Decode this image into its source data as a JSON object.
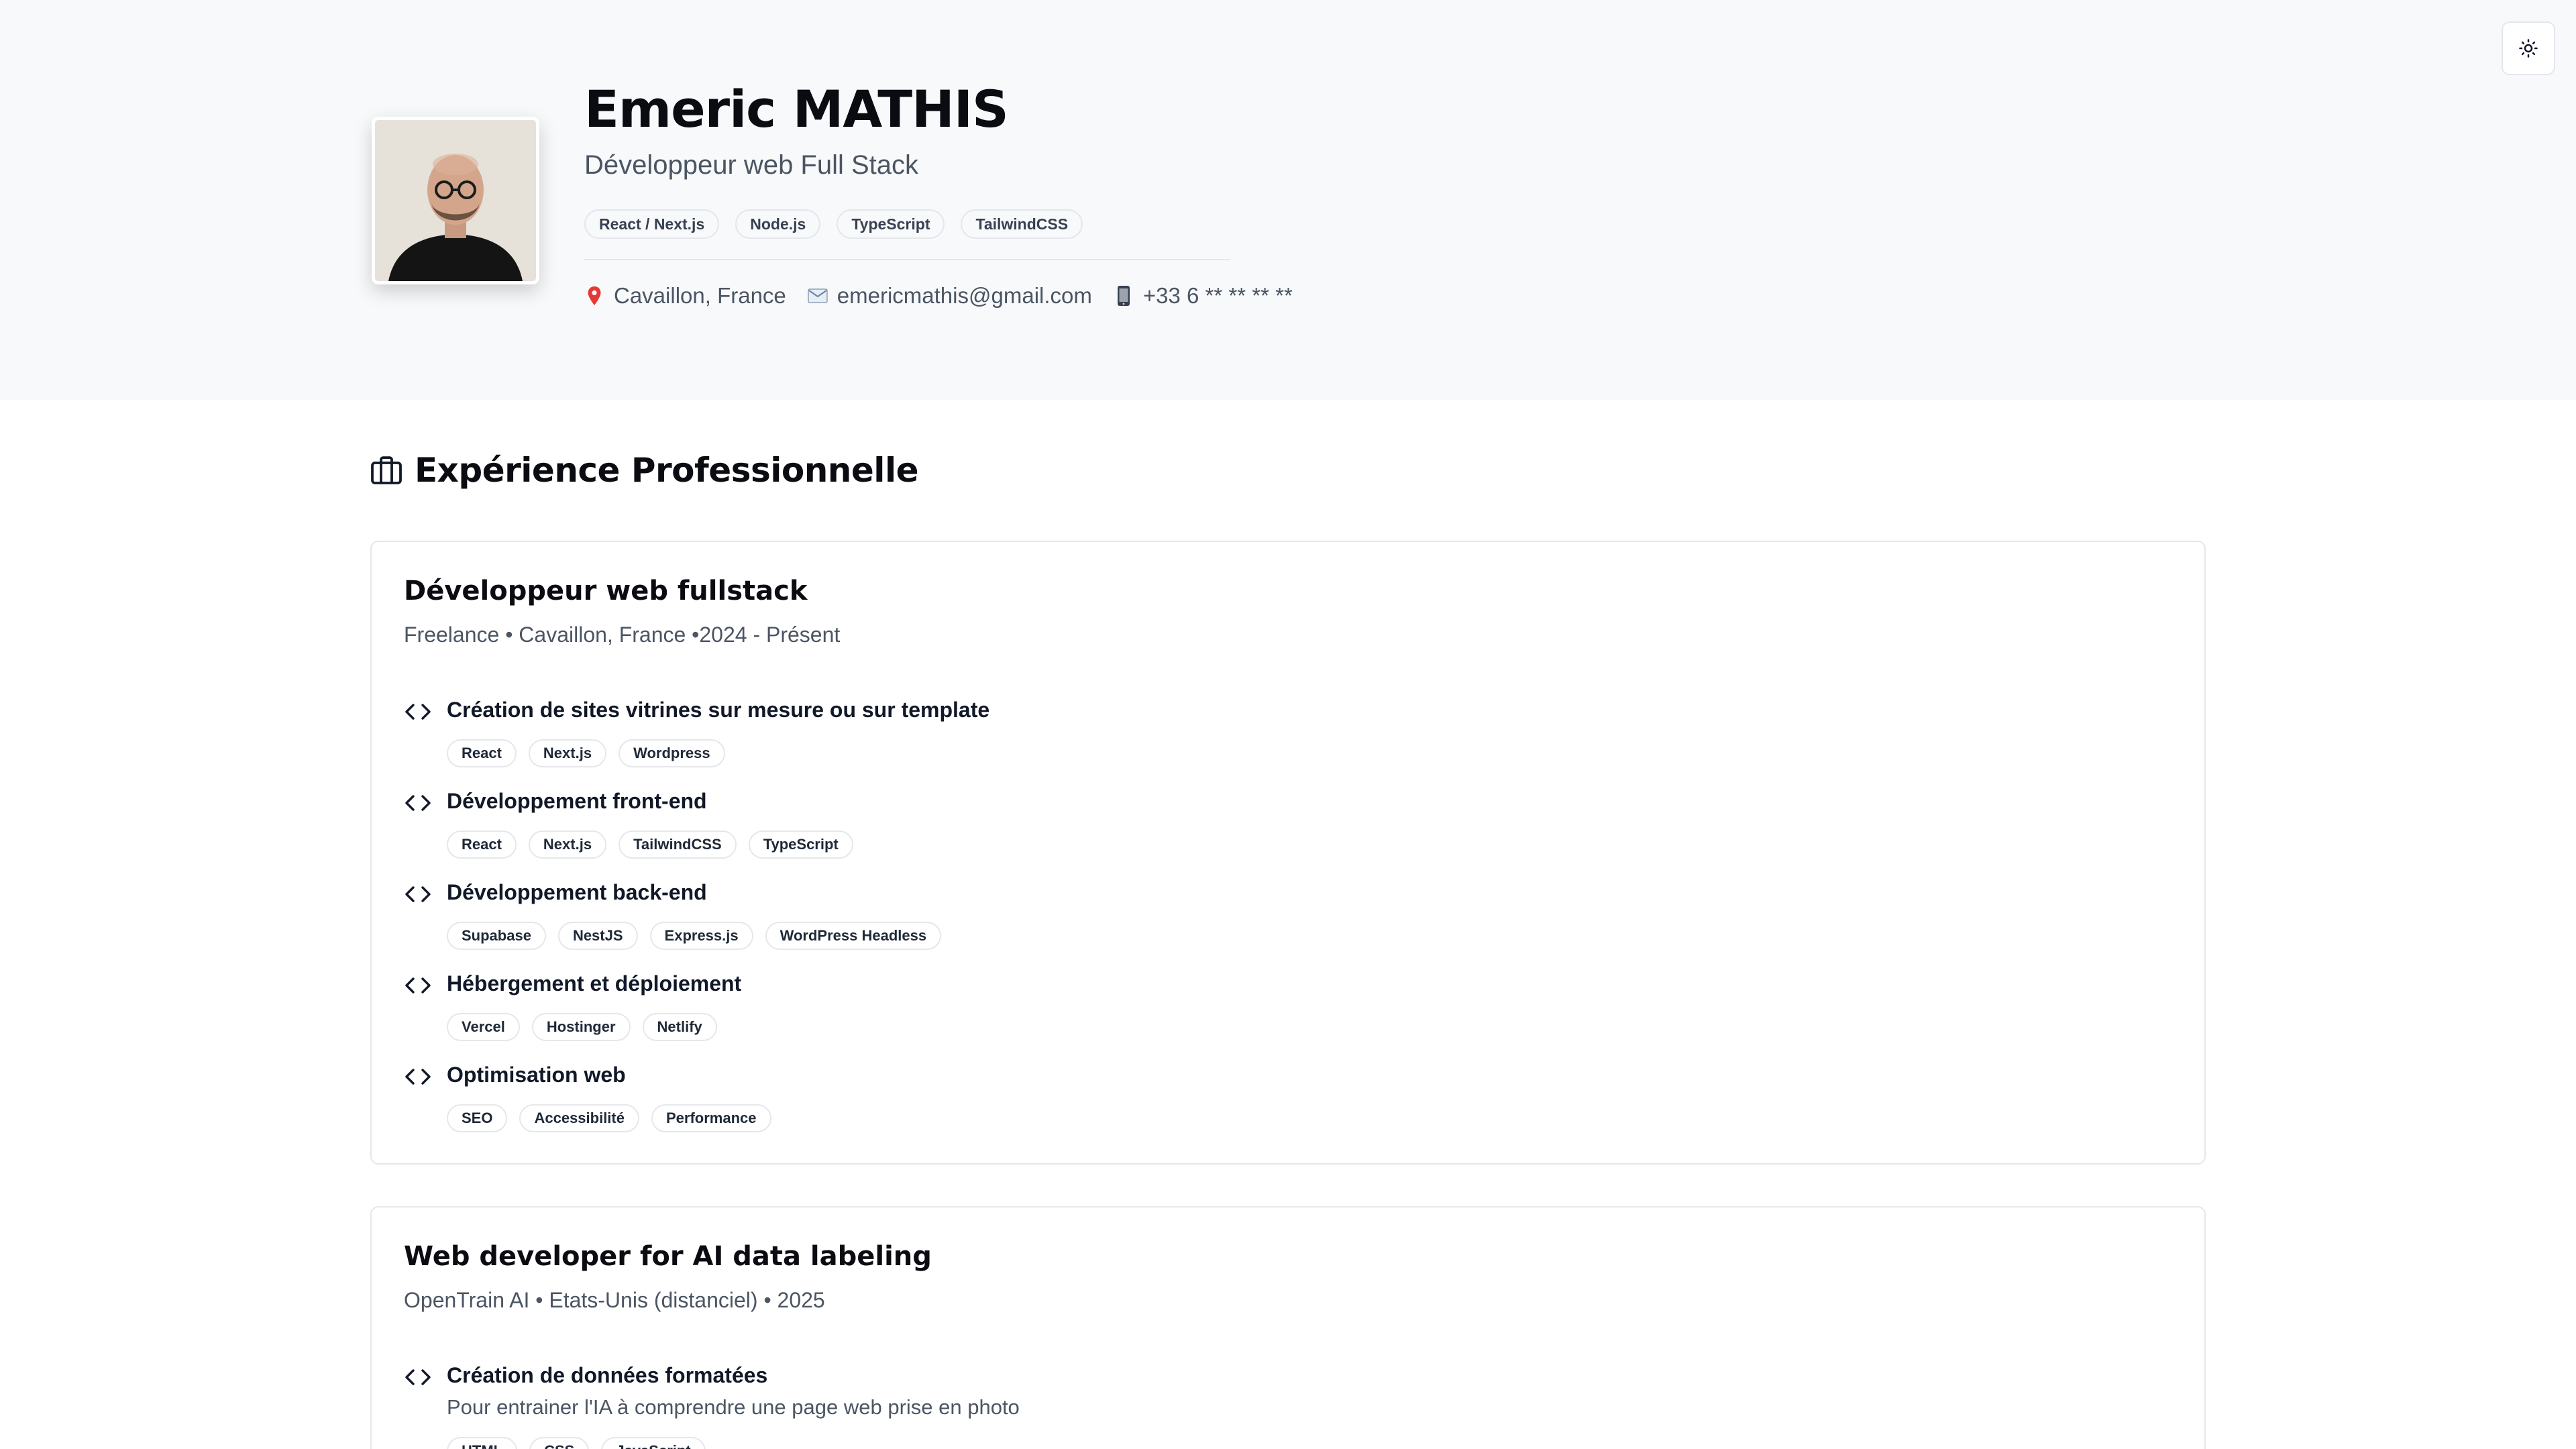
{
  "profile": {
    "name": "Emeric MATHIS",
    "role": "Développeur web Full Stack",
    "skills": [
      "React / Next.js",
      "Node.js",
      "TypeScript",
      "TailwindCSS"
    ],
    "location": "Cavaillon, France",
    "email": "emericmathis@gmail.com",
    "phone": "+33 6 ** ** ** **",
    "icons": {
      "location": "map-pin-icon",
      "email": "envelope-icon",
      "phone": "mobile-phone-icon",
      "theme": "sun-icon"
    }
  },
  "experience": {
    "title": "Expérience Professionnelle",
    "jobs": [
      {
        "title": "Développeur web fullstack",
        "meta": "Freelance • Cavaillon, France •2024 - Présent",
        "tasks": [
          {
            "title": "Création de sites vitrines sur mesure ou sur template",
            "tags": [
              "React",
              "Next.js",
              "Wordpress"
            ]
          },
          {
            "title": "Développement front-end",
            "tags": [
              "React",
              "Next.js",
              "TailwindCSS",
              "TypeScript"
            ]
          },
          {
            "title": "Développement back-end",
            "tags": [
              "Supabase",
              "NestJS",
              "Express.js",
              "WordPress Headless"
            ]
          },
          {
            "title": "Hébergement et déploiement",
            "tags": [
              "Vercel",
              "Hostinger",
              "Netlify"
            ]
          },
          {
            "title": "Optimisation web",
            "tags": [
              "SEO",
              "Accessibilité",
              "Performance"
            ]
          }
        ]
      },
      {
        "title": "Web developer for AI data labeling",
        "meta": "OpenTrain AI • Etats-Unis (distanciel) • 2025",
        "tasks": [
          {
            "title": "Création de données formatées",
            "desc": "Pour entrainer l'IA à comprendre une page web prise en photo",
            "tags": [
              "HTML",
              "CSS",
              "JavaScript"
            ]
          }
        ]
      }
    ]
  }
}
